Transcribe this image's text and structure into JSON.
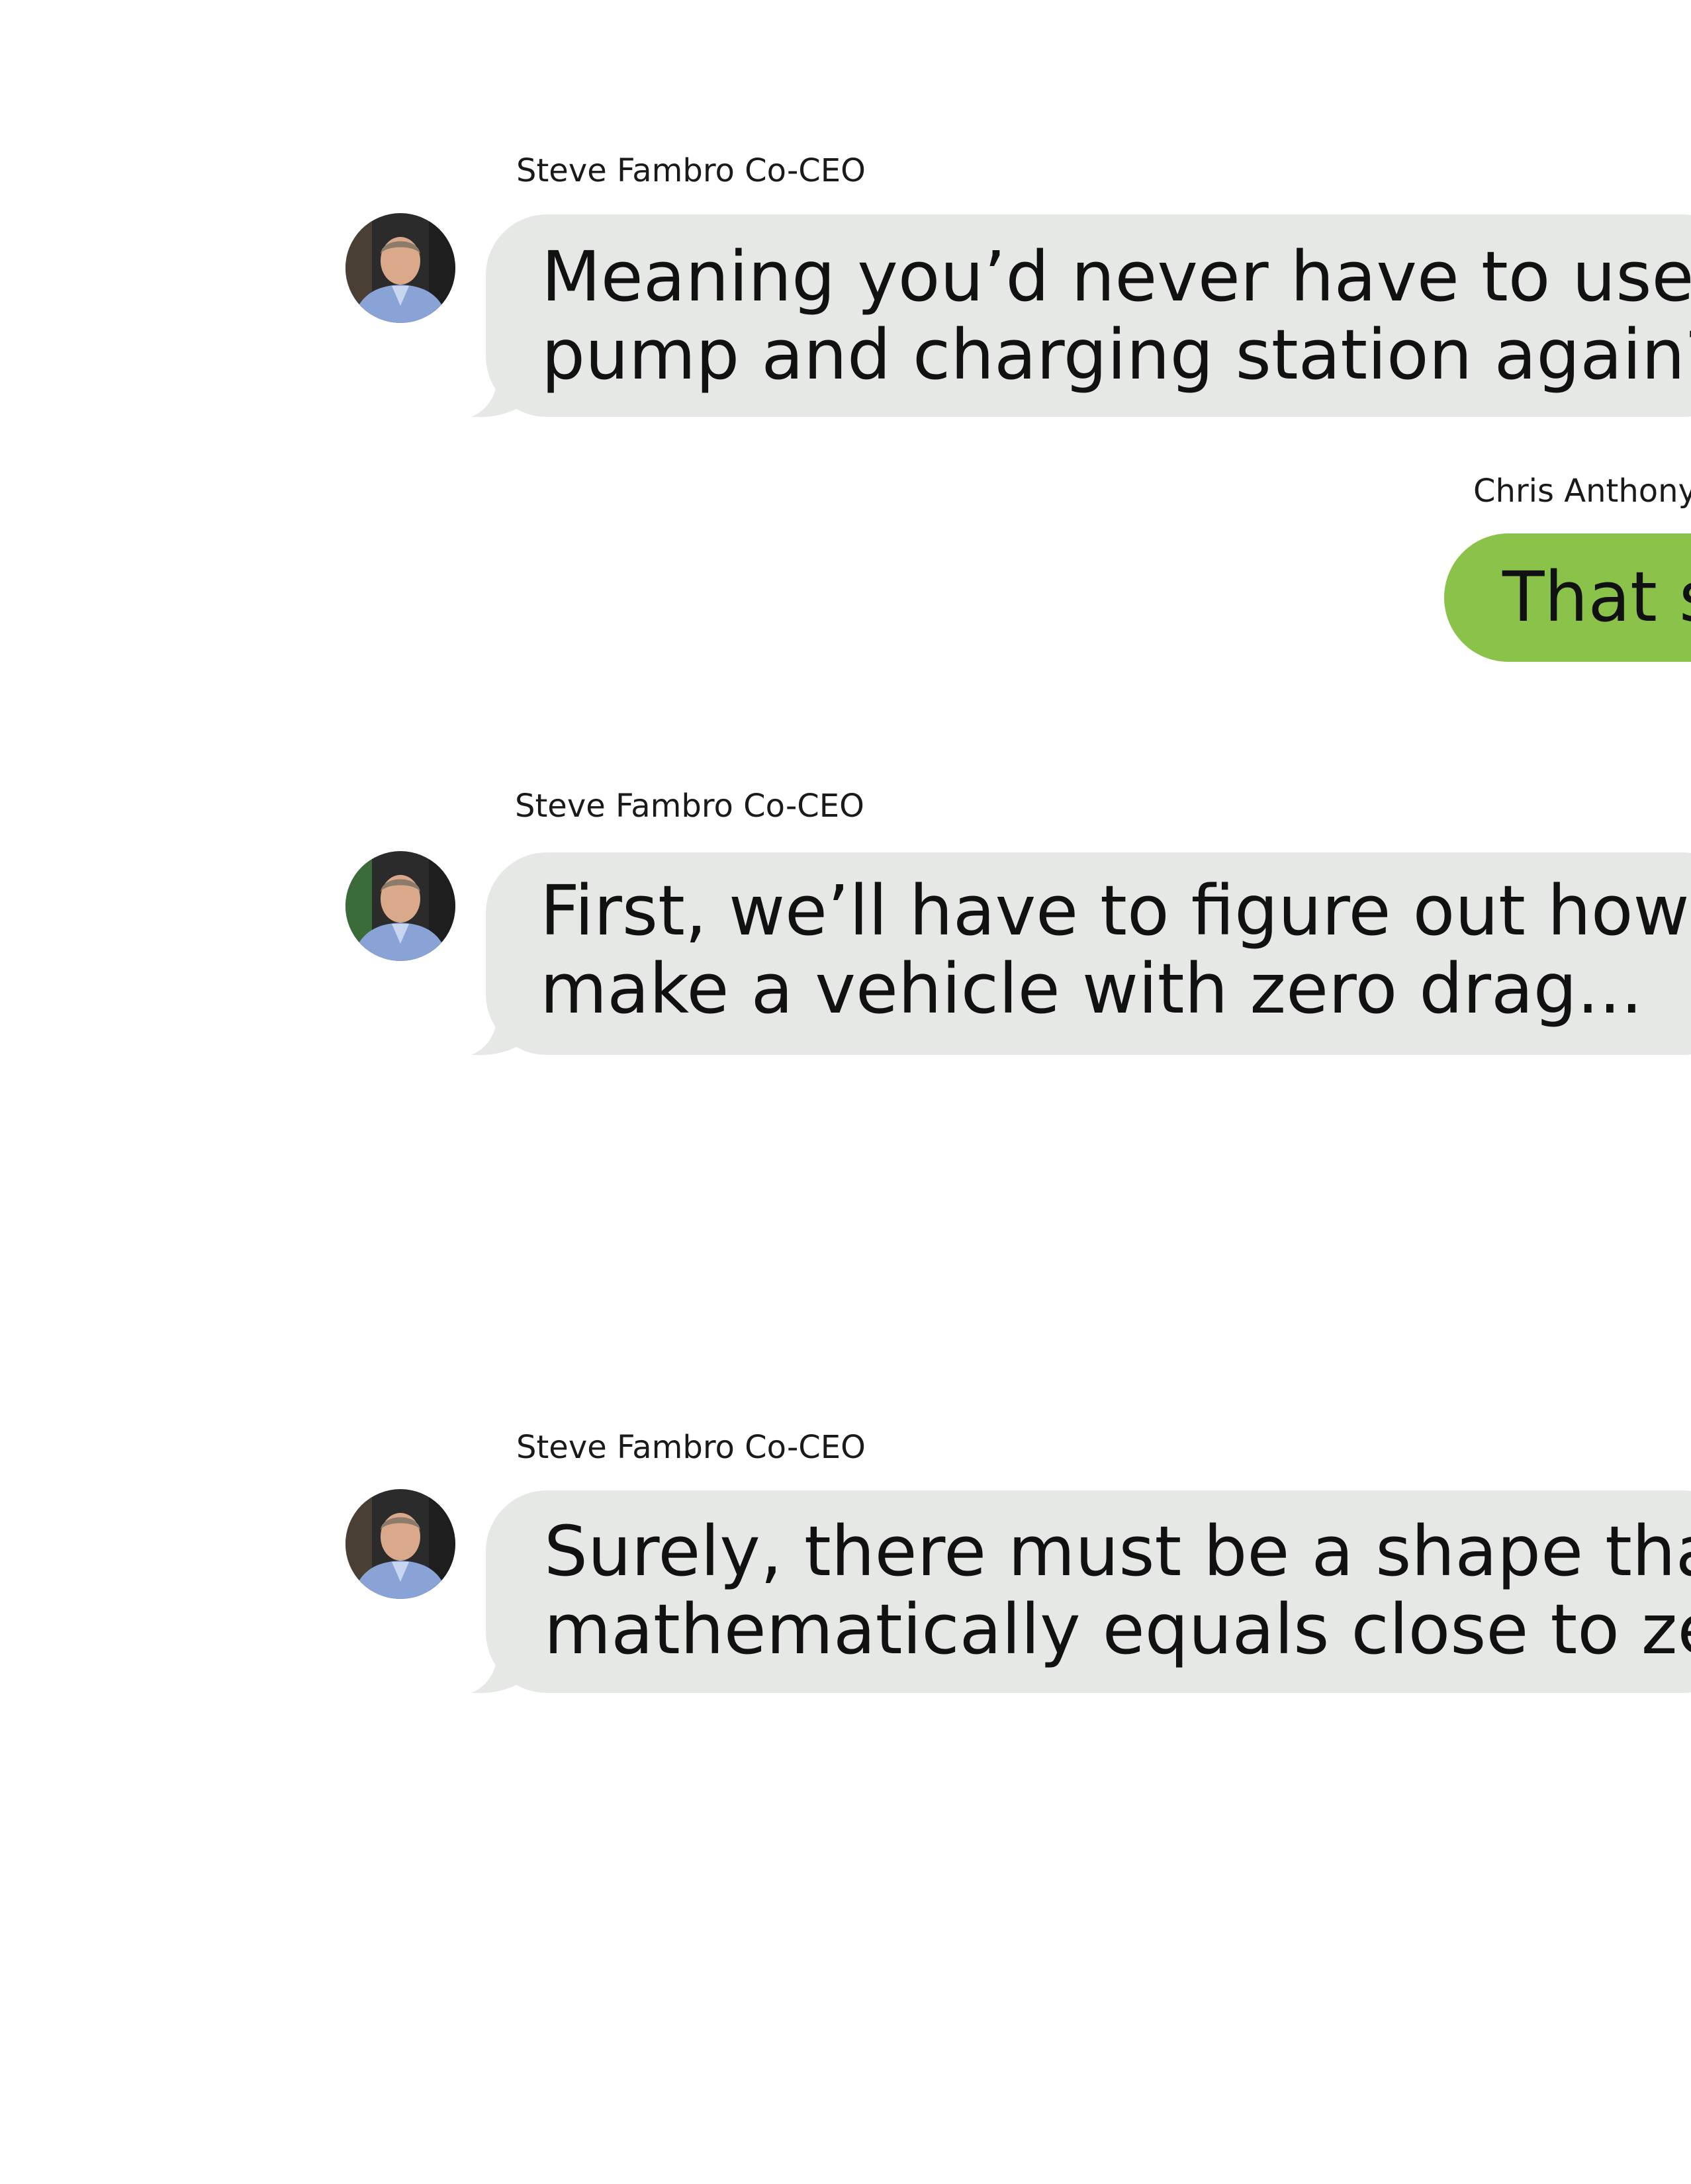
{
  "thread": {
    "messages": [
      {
        "sender": "Steve Fambro Co-CEO",
        "direction": "incoming",
        "avatar_icon": "person-avatar-icon",
        "lines": [
          "Meaning you’d never have to use the",
          "pump and charging station again?"
        ]
      },
      {
        "sender": "Chris Anthony",
        "direction": "outgoing",
        "lines": [
          "That s"
        ]
      },
      {
        "sender": "Steve Fambro Co-CEO",
        "direction": "incoming",
        "avatar_icon": "person-avatar-icon",
        "lines": [
          "First, we’ll have to figure out how to",
          "make a vehicle with zero drag..."
        ]
      },
      {
        "sender": "Steve Fambro Co-CEO",
        "direction": "incoming",
        "avatar_icon": "person-avatar-icon",
        "lines": [
          "Surely, there must be a shape that’s",
          "mathematically equals close to zero f"
        ]
      }
    ]
  },
  "colors": {
    "incoming_bubble": "#e6e8e6",
    "outgoing_bubble": "#8bc34a",
    "background": "#ffffff",
    "text": "#111111"
  }
}
